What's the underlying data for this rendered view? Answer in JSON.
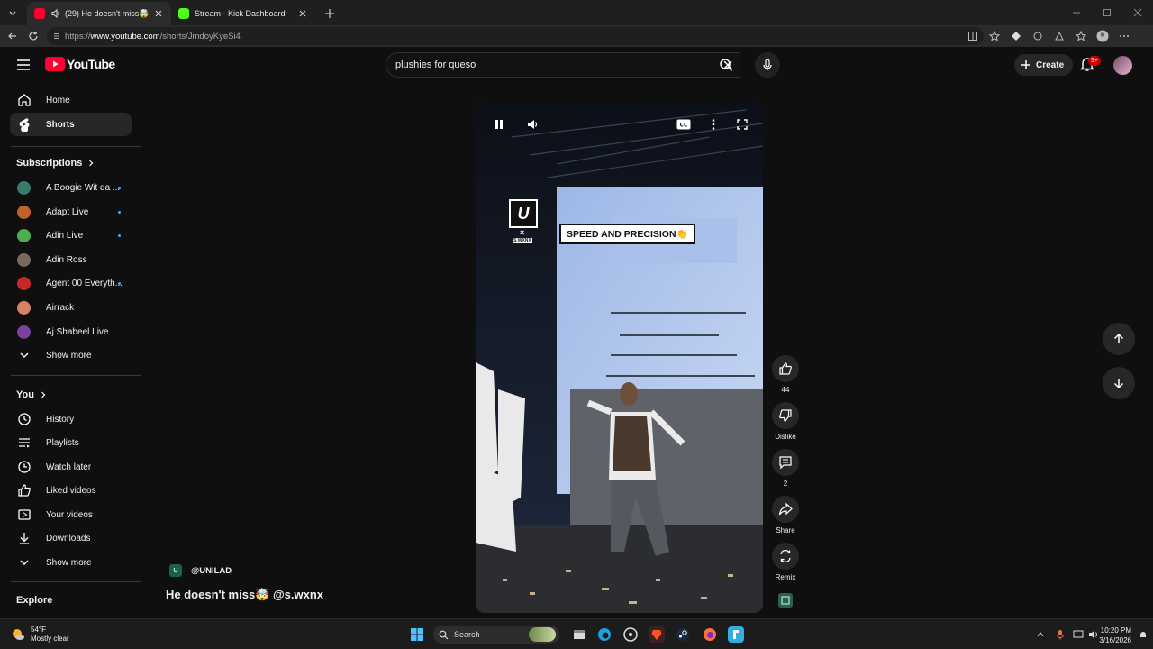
{
  "browser": {
    "tabs": [
      {
        "title": "(29) He doesn't miss🤯 @s.wxnx",
        "active": true,
        "favicon_color": "#ff0033"
      },
      {
        "title": "Stream - Kick Dashboard",
        "active": false,
        "favicon_color": "#53fc18"
      }
    ],
    "url_prefix": "https://",
    "url_host": "www.youtube.com",
    "url_path": "/shorts/JmdoyKyeSi4"
  },
  "header": {
    "logo_text": "YouTube",
    "search_value": "plushies for queso",
    "create_label": "Create",
    "notification_badge": "9+"
  },
  "sidebar": {
    "main": [
      {
        "label": "Home",
        "icon": "home-icon",
        "active": false
      },
      {
        "label": "Shorts",
        "icon": "shorts-icon",
        "active": true
      }
    ],
    "subscriptions_heading": "Subscriptions",
    "subscriptions": [
      {
        "label": "A Boogie Wit da ...",
        "color": "#3b7a6a",
        "new": true
      },
      {
        "label": "Adapt Live",
        "color": "#c0622a",
        "new": true
      },
      {
        "label": "Adin Live",
        "color": "#4caf50",
        "new": true
      },
      {
        "label": "Adin Ross",
        "color": "#7a6a5e",
        "new": false
      },
      {
        "label": "Agent 00 Everyth...",
        "color": "#c62828",
        "new": true
      },
      {
        "label": "Airrack",
        "color": "#d9826a",
        "new": false
      },
      {
        "label": "Aj Shabeel Live",
        "color": "#7b3fa0",
        "new": false
      }
    ],
    "subs_show_more": "Show more",
    "you_heading": "You",
    "you_items": [
      {
        "label": "History",
        "icon": "history-icon"
      },
      {
        "label": "Playlists",
        "icon": "playlists-icon"
      },
      {
        "label": "Watch later",
        "icon": "watch-later-icon"
      },
      {
        "label": "Liked videos",
        "icon": "thumbs-up-icon"
      },
      {
        "label": "Your videos",
        "icon": "your-videos-icon"
      },
      {
        "label": "Downloads",
        "icon": "download-icon"
      }
    ],
    "you_show_more": "Show more",
    "explore_heading": "Explore"
  },
  "short": {
    "channel": "@UNILAD",
    "title": "He doesn't miss🤯 @s.wxnx",
    "overlay_caption": "SPEED AND PRECISION👏",
    "overlay_logo": "U",
    "overlay_x": "×",
    "overlay_credit": "S.WXNX",
    "likes": "44",
    "dislike_label": "Dislike",
    "comments": "2",
    "share_label": "Share",
    "remix_label": "Remix"
  },
  "taskbar": {
    "weather_temp": "54°F",
    "weather_desc": "Mostly clear",
    "search_label": "Search",
    "time": "10:20 PM",
    "date": "3/16/2026"
  }
}
